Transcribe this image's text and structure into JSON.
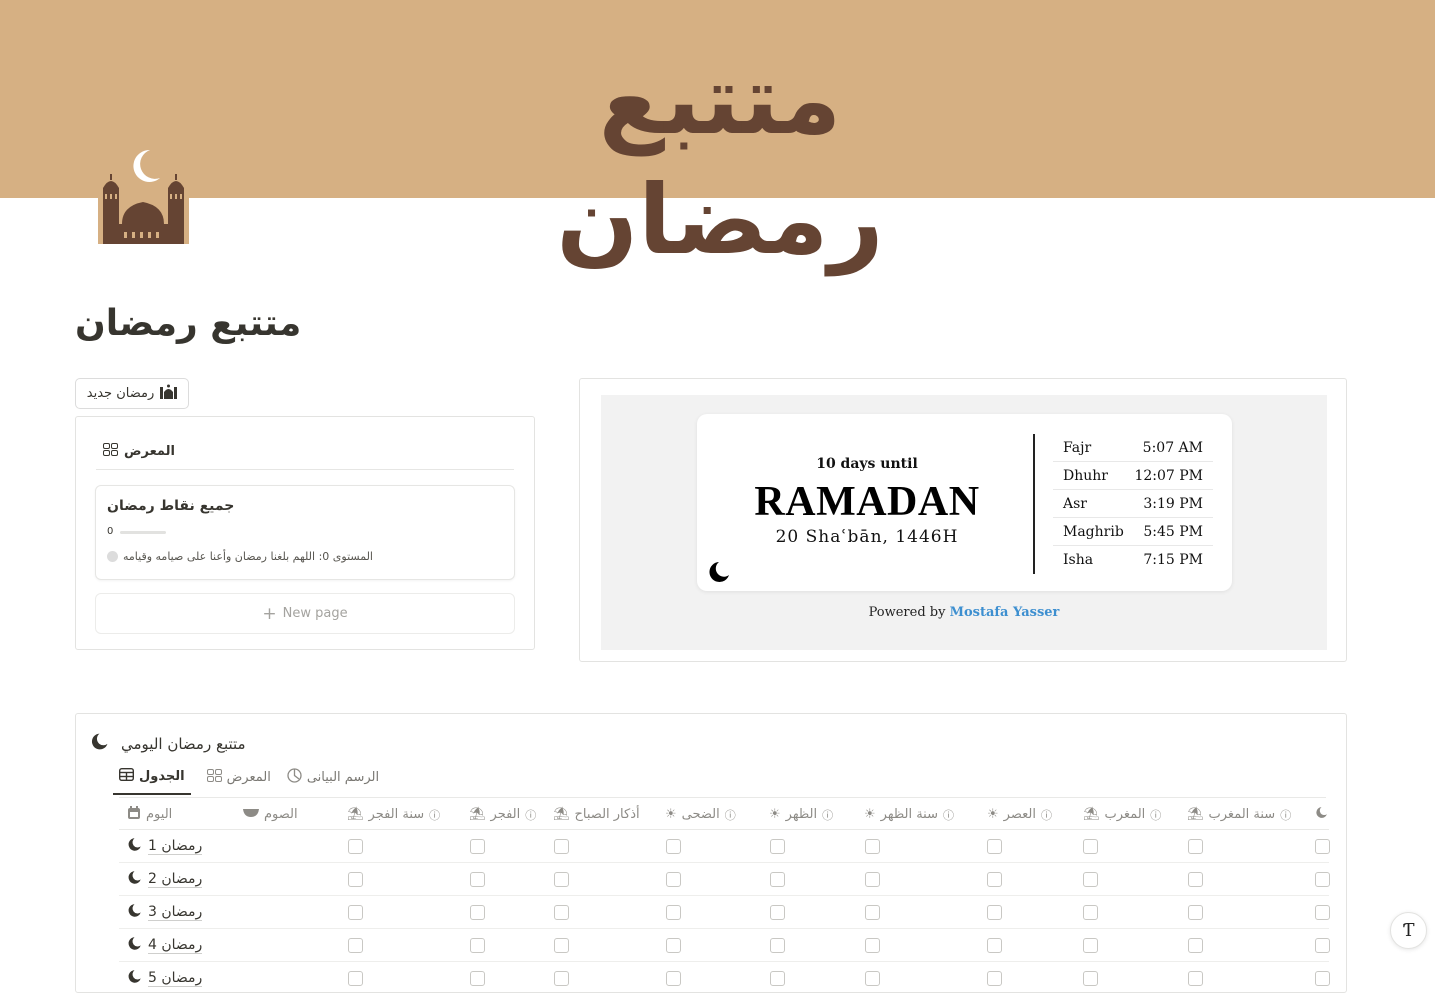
{
  "cover": {
    "title": "متتبع رمضان",
    "background_color": "#d6b083",
    "text_color": "#654433"
  },
  "page": {
    "icon": "mosque-crescent-icon",
    "title": "متتبع رمضان"
  },
  "new_button": {
    "label": "رمضان جديد",
    "icon": "mosque-icon"
  },
  "gallery": {
    "view_label": "المعرض",
    "view_icon": "gallery-grid-icon",
    "card": {
      "title": "جميع نقاط رمضان",
      "points": "0",
      "progress": 0,
      "level_text": "المستوى 0: اللهم بلغنا رمضان وأعنا على صيامه وقيامه"
    },
    "new_page_label": "New page"
  },
  "widget": {
    "countdown_text": "10 days until",
    "event": "RAMADAN",
    "hijri_date": "20 Shaʿbān, 1446H",
    "prayers": [
      {
        "name": "Fajr",
        "time": "5:07 AM"
      },
      {
        "name": "Dhuhr",
        "time": "12:07 PM"
      },
      {
        "name": "Asr",
        "time": "3:19 PM"
      },
      {
        "name": "Maghrib",
        "time": "5:45 PM"
      },
      {
        "name": "Isha",
        "time": "7:15 PM"
      }
    ],
    "powered_by": "Powered by",
    "author": "Mostafa Yasser",
    "link_color": "#3d8fd0"
  },
  "database": {
    "title": "متتبع رمضان اليومي",
    "tabs": [
      {
        "label": "الجدول",
        "icon": "table-icon",
        "active": true
      },
      {
        "label": "المعرض",
        "icon": "gallery-grid-icon",
        "active": false
      },
      {
        "label": "الرسم البيانى",
        "icon": "chart-icon",
        "active": false
      }
    ],
    "columns": [
      {
        "label": "اليوم",
        "icon": "calendar-icon"
      },
      {
        "label": "الصوم",
        "icon": "bowl-icon"
      },
      {
        "label": "سنة الفجر",
        "icon": "sunrise-icon"
      },
      {
        "label": "الفجر",
        "icon": "sunrise-icon"
      },
      {
        "label": "أذكار الصباح",
        "icon": "sunrise-icon"
      },
      {
        "label": "الضحى",
        "icon": "sun-icon"
      },
      {
        "label": "الظهر",
        "icon": "sun-icon"
      },
      {
        "label": "سنة الظهر",
        "icon": "sun-icon"
      },
      {
        "label": "العصر",
        "icon": "sun-icon"
      },
      {
        "label": "المغرب",
        "icon": "sunset-icon"
      },
      {
        "label": "سنة المغرب",
        "icon": "sunset-icon"
      },
      {
        "label": "",
        "icon": "moon-icon"
      }
    ],
    "rows": [
      {
        "name": "رمضان 1"
      },
      {
        "name": "رمضان 2"
      },
      {
        "name": "رمضان 3"
      },
      {
        "name": "رمضان 4"
      },
      {
        "name": "رمضان 5"
      }
    ]
  },
  "help_button": {
    "label": "?"
  }
}
